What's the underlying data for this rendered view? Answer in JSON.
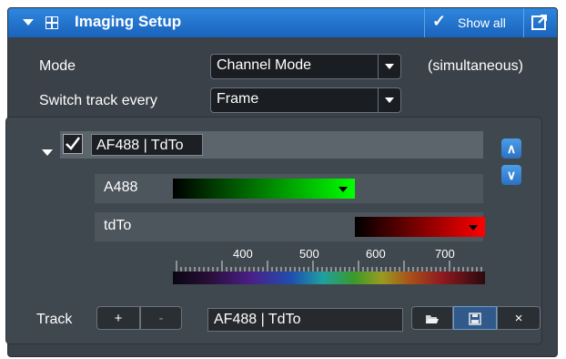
{
  "header": {
    "title": "Imaging Setup",
    "show_all": "Show all"
  },
  "mode": {
    "label": "Mode",
    "value": "Channel Mode",
    "note": "(simultaneous)"
  },
  "switch": {
    "label": "Switch track every",
    "value": "Frame"
  },
  "track": {
    "name": "AF488 | TdTo",
    "checked": true,
    "channels": [
      {
        "name": "A488",
        "color": "#00ff00"
      },
      {
        "name": "tdTo",
        "color": "#ff0000"
      }
    ]
  },
  "spectrum": {
    "ticks": [
      "400",
      "500",
      "600",
      "700"
    ]
  },
  "footer": {
    "label": "Track",
    "add": "+",
    "remove": "-",
    "track_value": "AF488 | TdTo",
    "close": "×"
  },
  "icons": {
    "open": "folder-open-icon",
    "save": "floppy-disk-icon"
  }
}
